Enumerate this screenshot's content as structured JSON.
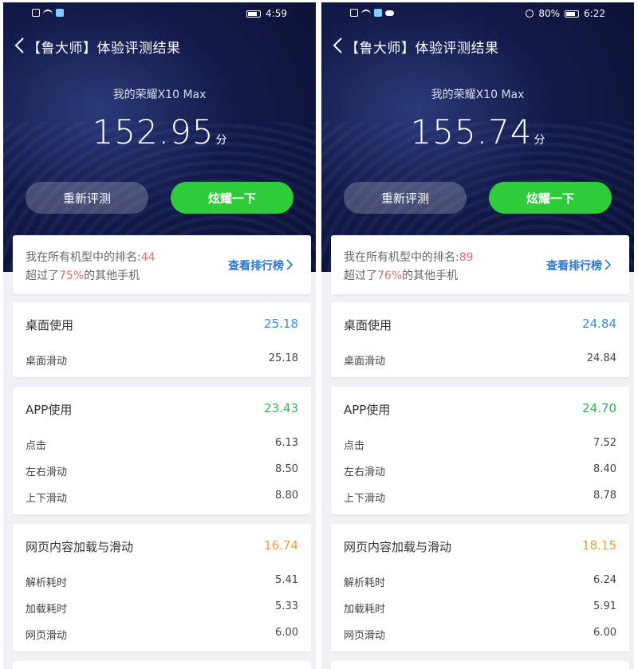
{
  "screens": [
    {
      "status": {
        "time": "4:59",
        "battery": ""
      },
      "title": "【鲁大师】体验评测结果",
      "device": "我的荣耀X10 Max",
      "score": "152.95",
      "score_unit": "分",
      "buttons": {
        "retest": "重新评测",
        "show": "炫耀一下"
      },
      "rank": {
        "prefix": "我在所有机型中的排名:",
        "position": "44",
        "beat_prefix": "超过了",
        "beat_percent": "75%",
        "beat_suffix": "的其他手机",
        "link": "查看排行榜"
      },
      "sections": [
        {
          "title": "桌面使用",
          "score": "25.18",
          "rows": [
            {
              "label": "桌面滑动",
              "value": "25.18"
            }
          ]
        },
        {
          "title": "APP使用",
          "score": "23.43",
          "rows": [
            {
              "label": "点击",
              "value": "6.13"
            },
            {
              "label": "左右滑动",
              "value": "8.50"
            },
            {
              "label": "上下滑动",
              "value": "8.80"
            }
          ]
        },
        {
          "title": "网页内容加载与滑动",
          "score": "16.74",
          "rows": [
            {
              "label": "解析耗时",
              "value": "5.41"
            },
            {
              "label": "加载耗时",
              "value": "5.33"
            },
            {
              "label": "网页滑动",
              "value": "6.00"
            }
          ]
        }
      ]
    },
    {
      "status": {
        "time": "6:22",
        "battery": "80%"
      },
      "title": "【鲁大师】体验评测结果",
      "device": "我的荣耀X10 Max",
      "score": "155.74",
      "score_unit": "分",
      "buttons": {
        "retest": "重新评测",
        "show": "炫耀一下"
      },
      "rank": {
        "prefix": "我在所有机型中的排名:",
        "position": "89",
        "beat_prefix": "超过了",
        "beat_percent": "76%",
        "beat_suffix": "的其他手机",
        "link": "查看排行榜"
      },
      "sections": [
        {
          "title": "桌面使用",
          "score": "24.84",
          "rows": [
            {
              "label": "桌面滑动",
              "value": "24.84"
            }
          ]
        },
        {
          "title": "APP使用",
          "score": "24.70",
          "rows": [
            {
              "label": "点击",
              "value": "7.52"
            },
            {
              "label": "左右滑动",
              "value": "8.40"
            },
            {
              "label": "上下滑动",
              "value": "8.78"
            }
          ]
        },
        {
          "title": "网页内容加载与滑动",
          "score": "18.15",
          "rows": [
            {
              "label": "解析耗时",
              "value": "6.24"
            },
            {
              "label": "加载耗时",
              "value": "5.91"
            },
            {
              "label": "网页滑动",
              "value": "6.00"
            }
          ]
        }
      ]
    }
  ],
  "colors": {
    "green_button": "#2fcc3a",
    "link_blue": "#2a76d2",
    "rank_red": "#f06a6a",
    "section1": "#3690e0",
    "section2": "#2fb84a",
    "section3": "#f09a3c",
    "hero_dark": "#0a0f30"
  }
}
